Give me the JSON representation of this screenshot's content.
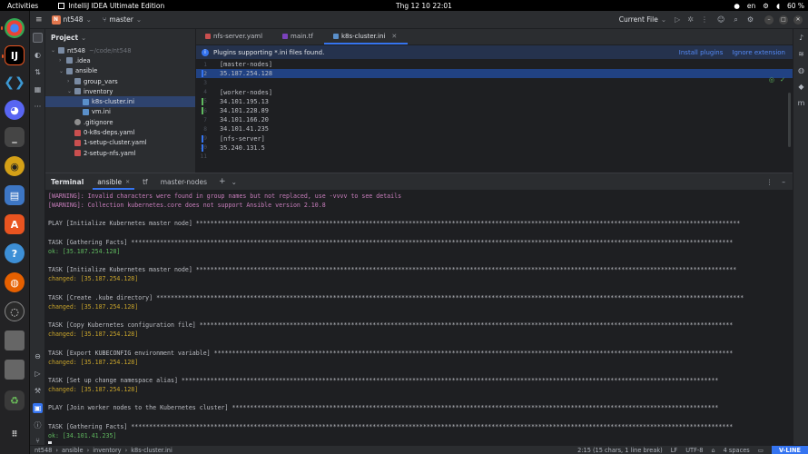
{
  "topbar": {
    "activities": "Activities",
    "app_name": "IntelliJ IDEA Ultimate Edition",
    "clock": "Thg 12 10  22:01",
    "language": "en",
    "battery": "60 %"
  },
  "titlebar": {
    "project_badge": "N",
    "project_name": "nt548",
    "branch": "master",
    "run_config": "Current File"
  },
  "project_pane": {
    "title": "Project",
    "items": [
      {
        "label": "nt548",
        "path": "~/code/nt548",
        "depth": 0,
        "kind": "folder",
        "open": true
      },
      {
        "label": ".idea",
        "depth": 1,
        "kind": "folder",
        "open": false
      },
      {
        "label": "ansible",
        "depth": 1,
        "kind": "folder",
        "open": true
      },
      {
        "label": "group_vars",
        "depth": 2,
        "kind": "folder",
        "open": false
      },
      {
        "label": "inventory",
        "depth": 2,
        "kind": "folder",
        "open": true
      },
      {
        "label": "k8s-cluster.ini",
        "depth": 3,
        "kind": "ini",
        "selected": true
      },
      {
        "label": "vm.ini",
        "depth": 3,
        "kind": "ini"
      },
      {
        "label": ".gitignore",
        "depth": 2,
        "kind": "git"
      },
      {
        "label": "0-k8s-deps.yaml",
        "depth": 2,
        "kind": "yaml"
      },
      {
        "label": "1-setup-cluster.yaml",
        "depth": 2,
        "kind": "yaml"
      },
      {
        "label": "2-setup-nfs.yaml",
        "depth": 2,
        "kind": "yaml"
      }
    ]
  },
  "editor": {
    "tabs": [
      {
        "label": "nfs-server.yaml",
        "icon": "yaml",
        "active": false
      },
      {
        "label": "main.tf",
        "icon": "tf",
        "active": false
      },
      {
        "label": "k8s-cluster.ini",
        "icon": "ini",
        "active": true
      }
    ],
    "banner": {
      "text": "Plugins supporting *.ini files found.",
      "install": "Install plugins",
      "ignore": "Ignore extension"
    },
    "lines": [
      {
        "n": "1",
        "text": "[master-nodes]"
      },
      {
        "n": "2",
        "text": "35.187.254.128",
        "hl": true
      },
      {
        "n": "3",
        "text": ""
      },
      {
        "n": "4",
        "text": "[worker-nodes]"
      },
      {
        "n": "5",
        "text": "34.101.195.13"
      },
      {
        "n": "6",
        "text": "34.101.228.89"
      },
      {
        "n": "7",
        "text": "34.101.166.20"
      },
      {
        "n": "8",
        "text": "34.101.41.235"
      },
      {
        "n": "9",
        "text": "[nfs-server]"
      },
      {
        "n": "10",
        "text": "35.240.131.5"
      },
      {
        "n": "11",
        "text": ""
      }
    ]
  },
  "terminal": {
    "title": "Terminal",
    "tabs": [
      {
        "label": "ansible",
        "active": true
      },
      {
        "label": "tf",
        "active": false
      },
      {
        "label": "master-nodes",
        "active": false
      }
    ],
    "lines": [
      {
        "kind": "warn",
        "text": "[WARNING]: Invalid characters were found in group names but not replaced, use -vvvv to see details"
      },
      {
        "kind": "warn",
        "text": "[WARNING]: Collection kubernetes.core does not support Ansible version 2.10.8"
      },
      {
        "kind": "blank",
        "text": ""
      },
      {
        "kind": "play",
        "text": "PLAY [Initialize Kubernetes master node] *******************************************************************************************************************************************************"
      },
      {
        "kind": "blank",
        "text": ""
      },
      {
        "kind": "play",
        "text": "TASK [Gathering Facts] ***********************************************************************************************************************************************************************"
      },
      {
        "kind": "ok",
        "text": "ok: [35.187.254.128]"
      },
      {
        "kind": "blank",
        "text": ""
      },
      {
        "kind": "play",
        "text": "TASK [Initialize Kubernetes master node] ******************************************************************************************************************************************************"
      },
      {
        "kind": "changed",
        "text": "changed: [35.187.254.128]"
      },
      {
        "kind": "blank",
        "text": ""
      },
      {
        "kind": "play",
        "text": "TASK [Create .kube directory] *******************************************************************************************************************************************************************"
      },
      {
        "kind": "changed",
        "text": "changed: [35.187.254.128]"
      },
      {
        "kind": "blank",
        "text": ""
      },
      {
        "kind": "play",
        "text": "TASK [Copy Kubernetes configuration file] ****************************************************************************************************************************************************"
      },
      {
        "kind": "changed",
        "text": "changed: [35.187.254.128]"
      },
      {
        "kind": "blank",
        "text": ""
      },
      {
        "kind": "play",
        "text": "TASK [Export KUBECONFIG environment variable] ************************************************************************************************************************************************"
      },
      {
        "kind": "changed",
        "text": "changed: [35.187.254.128]"
      },
      {
        "kind": "blank",
        "text": ""
      },
      {
        "kind": "play",
        "text": "TASK [Set up change namespace alias] *****************************************************************************************************************************************************"
      },
      {
        "kind": "changed",
        "text": "changed: [35.187.254.128]"
      },
      {
        "kind": "blank",
        "text": ""
      },
      {
        "kind": "play",
        "text": "PLAY [Join worker nodes to the Kubernetes cluster] ***************************************************************************************************************************************"
      },
      {
        "kind": "blank",
        "text": ""
      },
      {
        "kind": "play",
        "text": "TASK [Gathering Facts] ***********************************************************************************************************************************************************************"
      },
      {
        "kind": "ok",
        "text": "ok: [34.101.41.235]"
      }
    ]
  },
  "statusbar": {
    "crumbs": [
      "nt548",
      "ansible",
      "inventory",
      "k8s-cluster.ini"
    ],
    "position": "2:15 (15 chars, 1 line break)",
    "line_ending": "LF",
    "encoding": "UTF-8",
    "indent": "4 spaces",
    "mode": "V-LINE"
  },
  "colors": {
    "accent": "#3574f0",
    "warning": "#c77dbb",
    "ok": "#5fb85f",
    "changed": "#c7a32b"
  }
}
